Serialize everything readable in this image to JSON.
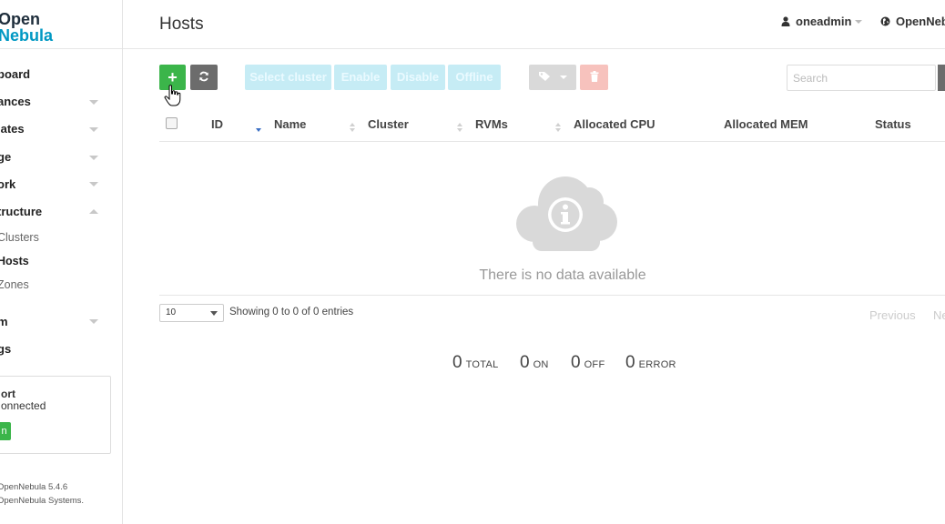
{
  "sidebar": {
    "logo": {
      "line1": "Open",
      "line2": "Nebula"
    },
    "items": [
      {
        "label": "board",
        "expandable": false
      },
      {
        "label": "ances",
        "expandable": true
      },
      {
        "label": "lates",
        "expandable": true
      },
      {
        "label": "ge",
        "expandable": true
      },
      {
        "label": "ork",
        "expandable": true
      },
      {
        "label": "tructure",
        "expandable": true,
        "expanded": true
      },
      {
        "label": "Clusters",
        "sub": true
      },
      {
        "label": "Hosts",
        "sub": true,
        "active": true
      },
      {
        "label": "Zones",
        "sub": true
      },
      {
        "label": "m",
        "expandable": true
      },
      {
        "label": "gs",
        "expandable": false
      }
    ],
    "support": {
      "title": "ort",
      "status": "onnected",
      "button_label": "n"
    },
    "footer": {
      "version": "OpenNebula 5.4.6",
      "copyright": "OpenNebula Systems."
    }
  },
  "header": {
    "title": "Hosts",
    "user": "oneadmin",
    "zone": "OpenNeb"
  },
  "toolbar": {
    "add_label": "+",
    "select_cluster_label": "Select cluster",
    "enable_label": "Enable",
    "disable_label": "Disable",
    "offline_label": "Offline",
    "search_placeholder": "Search"
  },
  "table": {
    "columns": [
      "ID",
      "Name",
      "Cluster",
      "RVMs",
      "Allocated CPU",
      "Allocated MEM",
      "Status"
    ],
    "empty_message": "There is no data available"
  },
  "paging": {
    "page_size": "10",
    "showing": "Showing 0 to 0 of 0 entries",
    "previous": "Previous",
    "next": "Ne"
  },
  "stats": {
    "total": {
      "value": "0",
      "label": "TOTAL"
    },
    "on": {
      "value": "0",
      "label": "ON"
    },
    "off": {
      "value": "0",
      "label": "OFF"
    },
    "error": {
      "value": "0",
      "label": "ERROR"
    }
  },
  "colors": {
    "accent_green": "#3bb54a",
    "logo_blue": "#0098c3",
    "sort_active": "#3b6fc4"
  }
}
